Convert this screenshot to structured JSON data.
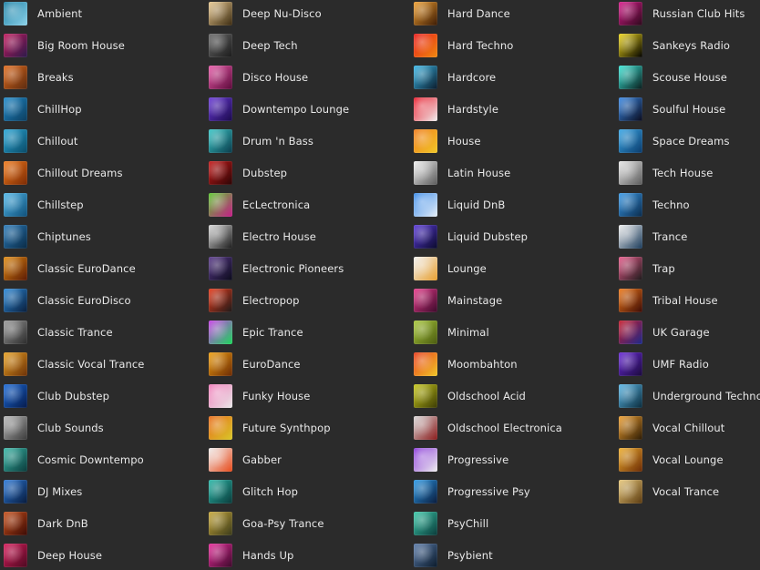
{
  "columns": [
    [
      {
        "label": "Ambient",
        "icon": "ambient-art-icon",
        "color1": "#1b7fa3",
        "color2": "#8fd3ea"
      },
      {
        "label": "Big Room House",
        "icon": "big-room-house-art-icon",
        "color1": "#c2185b",
        "color2": "#2a1a4a"
      },
      {
        "label": "Breaks",
        "icon": "breaks-art-icon",
        "color1": "#e06a1a",
        "color2": "#5a2a10"
      },
      {
        "label": "ChillHop",
        "icon": "chillhop-art-icon",
        "color1": "#1e88c8",
        "color2": "#0d3d5e"
      },
      {
        "label": "Chillout",
        "icon": "chillout-art-icon",
        "color1": "#29a6d6",
        "color2": "#0a4a66"
      },
      {
        "label": "Chillout Dreams",
        "icon": "chillout-dreams-art-icon",
        "color1": "#f07a1a",
        "color2": "#7a2a05"
      },
      {
        "label": "Chillstep",
        "icon": "chillstep-art-icon",
        "color1": "#4fb6e8",
        "color2": "#0f4f79"
      },
      {
        "label": "Chiptunes",
        "icon": "chiptunes-art-icon",
        "color1": "#2a7ab8",
        "color2": "#0a2a45"
      },
      {
        "label": "Classic EuroDance",
        "icon": "classic-eurodance-art-icon",
        "color1": "#e08a10",
        "color2": "#5a1a05"
      },
      {
        "label": "Classic EuroDisco",
        "icon": "classic-eurodisco-art-icon",
        "color1": "#2a88d8",
        "color2": "#0a1e3a"
      },
      {
        "label": "Classic Trance",
        "icon": "classic-trance-art-icon",
        "color1": "#9a9a9a",
        "color2": "#2a2a2a"
      },
      {
        "label": "Classic Vocal Trance",
        "icon": "classic-vocal-trance-art-icon",
        "color1": "#e8a020",
        "color2": "#6a3008"
      },
      {
        "label": "Club Dubstep",
        "icon": "club-dubstep-art-icon",
        "color1": "#1a6ad8",
        "color2": "#061a4a"
      },
      {
        "label": "Club Sounds",
        "icon": "club-sounds-art-icon",
        "color1": "#b8b8b8",
        "color2": "#3a3a3a"
      },
      {
        "label": "Cosmic Downtempo",
        "icon": "cosmic-downtempo-art-icon",
        "color1": "#3ab8a8",
        "color2": "#0a3a3a"
      },
      {
        "label": "DJ Mixes",
        "icon": "dj-mixes-art-icon",
        "color1": "#2a78d8",
        "color2": "#081a3a"
      },
      {
        "label": "Dark DnB",
        "icon": "dark-dnb-art-icon",
        "color1": "#c8501a",
        "color2": "#3a0a05"
      },
      {
        "label": "Deep House",
        "icon": "deep-house-art-icon",
        "color1": "#d81a5a",
        "color2": "#4a0a20"
      }
    ],
    [
      {
        "label": "Deep Nu-Disco",
        "icon": "deep-nu-disco-art-icon",
        "color1": "#e8c890",
        "color2": "#3a2a10"
      },
      {
        "label": "Deep Tech",
        "icon": "deep-tech-art-icon",
        "color1": "#6a6a6a",
        "color2": "#1a1a1a"
      },
      {
        "label": "Disco House",
        "icon": "disco-house-art-icon",
        "color1": "#e85aa8",
        "color2": "#5a0a3a"
      },
      {
        "label": "Downtempo Lounge",
        "icon": "downtempo-lounge-art-icon",
        "color1": "#6a3ad8",
        "color2": "#1a0a4a"
      },
      {
        "label": "Drum 'n Bass",
        "icon": "drum-n-bass-art-icon",
        "color1": "#3ac8c8",
        "color2": "#0a3a4a"
      },
      {
        "label": "Dubstep",
        "icon": "dubstep-art-icon",
        "color1": "#c81a1a",
        "color2": "#2a0505"
      },
      {
        "label": "EcLectronica",
        "icon": "eclectronica-art-icon",
        "color1": "#58c82a",
        "color2": "#c81a8a"
      },
      {
        "label": "Electro House",
        "icon": "electro-house-art-icon",
        "color1": "#d8d8d8",
        "color2": "#1a1a1a"
      },
      {
        "label": "Electronic Pioneers",
        "icon": "electronic-pioneers-art-icon",
        "color1": "#5a3a8a",
        "color2": "#0a0a1a"
      },
      {
        "label": "Electropop",
        "icon": "electropop-art-icon",
        "color1": "#e83a1a",
        "color2": "#1a1a1a"
      },
      {
        "label": "Epic Trance",
        "icon": "epic-trance-art-icon",
        "color1": "#c83ae8",
        "color2": "#1ad85a"
      },
      {
        "label": "EuroDance",
        "icon": "eurodance-art-icon",
        "color1": "#f0a010",
        "color2": "#6a2a05"
      },
      {
        "label": "Funky House",
        "icon": "funky-house-art-icon",
        "color1": "#f07ab8",
        "color2": "#e8e8e8"
      },
      {
        "label": "Future Synthpop",
        "icon": "future-synthpop-art-icon",
        "color1": "#e86a1a",
        "color2": "#d8c82a"
      },
      {
        "label": "Gabber",
        "icon": "gabber-art-icon",
        "color1": "#f0f0f0",
        "color2": "#e84a1a"
      },
      {
        "label": "Glitch Hop",
        "icon": "glitch-hop-art-icon",
        "color1": "#2ab8a8",
        "color2": "#0a3a3a"
      },
      {
        "label": "Goa-Psy Trance",
        "icon": "goa-psy-trance-art-icon",
        "color1": "#c8a83a",
        "color2": "#3a3a1a"
      },
      {
        "label": "Hands Up",
        "icon": "hands-up-art-icon",
        "color1": "#e82a9a",
        "color2": "#3a0a2a"
      }
    ],
    [
      {
        "label": "Hard Dance",
        "icon": "hard-dance-art-icon",
        "color1": "#f0a030",
        "color2": "#3a1a05"
      },
      {
        "label": "Hard Techno",
        "icon": "hard-techno-art-icon",
        "color1": "#e81a1a",
        "color2": "#f08a10"
      },
      {
        "label": "Hardcore",
        "icon": "hardcore-art-icon",
        "color1": "#3ab8e8",
        "color2": "#0a1a2a"
      },
      {
        "label": "Hardstyle",
        "icon": "hardstyle-art-icon",
        "color1": "#e81a2a",
        "color2": "#f0f0f0"
      },
      {
        "label": "House",
        "icon": "house-art-icon",
        "color1": "#f07a1a",
        "color2": "#f0c82a"
      },
      {
        "label": "Latin House",
        "icon": "latin-house-art-icon",
        "color1": "#f0f0f0",
        "color2": "#5a5a5a"
      },
      {
        "label": "Liquid DnB",
        "icon": "liquid-dnb-art-icon",
        "color1": "#3a8ae8",
        "color2": "#e8f0f8"
      },
      {
        "label": "Liquid Dubstep",
        "icon": "liquid-dubstep-art-icon",
        "color1": "#5a3ad8",
        "color2": "#0a0a2a"
      },
      {
        "label": "Lounge",
        "icon": "lounge-art-icon",
        "color1": "#f0f0f0",
        "color2": "#e8a030"
      },
      {
        "label": "Mainstage",
        "icon": "mainstage-art-icon",
        "color1": "#e83a8a",
        "color2": "#3a0a2a"
      },
      {
        "label": "Minimal",
        "icon": "minimal-art-icon",
        "color1": "#a8c83a",
        "color2": "#4a5a10"
      },
      {
        "label": "Moombahton",
        "icon": "moombahton-art-icon",
        "color1": "#e83a1a",
        "color2": "#f0c82a"
      },
      {
        "label": "Oldschool Acid",
        "icon": "oldschool-acid-art-icon",
        "color1": "#c8c81a",
        "color2": "#3a3a05"
      },
      {
        "label": "Oldschool Electronica",
        "icon": "oldschool-electronica-art-icon",
        "color1": "#d8d8d8",
        "color2": "#8a1a1a"
      },
      {
        "label": "Progressive",
        "icon": "progressive-art-icon",
        "color1": "#8a3ad8",
        "color2": "#f0f0f0"
      },
      {
        "label": "Progressive Psy",
        "icon": "progressive-psy-art-icon",
        "color1": "#2a9ae8",
        "color2": "#0a1a3a"
      },
      {
        "label": "PsyChill",
        "icon": "psychill-art-icon",
        "color1": "#3ac8a8",
        "color2": "#0a3a3a"
      },
      {
        "label": "Psybient",
        "icon": "psybient-art-icon",
        "color1": "#5a7aa8",
        "color2": "#0a1a2a"
      }
    ],
    [
      {
        "label": "Russian Club Hits",
        "icon": "russian-club-hits-art-icon",
        "color1": "#d81a8a",
        "color2": "#2a0a1a"
      },
      {
        "label": "Sankeys Radio",
        "icon": "sankeys-radio-art-icon",
        "color1": "#f0d81a",
        "color2": "#000000"
      },
      {
        "label": "Scouse House",
        "icon": "scouse-house-art-icon",
        "color1": "#3ae8d8",
        "color2": "#0a1a1a"
      },
      {
        "label": "Soulful House",
        "icon": "soulful-house-art-icon",
        "color1": "#3a8ae8",
        "color2": "#0a0a1a"
      },
      {
        "label": "Space Dreams",
        "icon": "space-dreams-art-icon",
        "color1": "#3aa8e8",
        "color2": "#0a3a6a"
      },
      {
        "label": "Tech House",
        "icon": "tech-house-art-icon",
        "color1": "#e8e8e8",
        "color2": "#5a5a5a"
      },
      {
        "label": "Techno",
        "icon": "techno-art-icon",
        "color1": "#3a9ae8",
        "color2": "#0a2a4a"
      },
      {
        "label": "Trance",
        "icon": "trance-art-icon",
        "color1": "#f0f0f0",
        "color2": "#1a3a5a"
      },
      {
        "label": "Trap",
        "icon": "trap-art-icon",
        "color1": "#e85a8a",
        "color2": "#1a1a1a"
      },
      {
        "label": "Tribal House",
        "icon": "tribal-house-art-icon",
        "color1": "#f07a1a",
        "color2": "#3a0a05"
      },
      {
        "label": "UK Garage",
        "icon": "uk-garage-art-icon",
        "color1": "#c81a2a",
        "color2": "#1a2a8a"
      },
      {
        "label": "UMF Radio",
        "icon": "umf-radio-art-icon",
        "color1": "#6a2ad8",
        "color2": "#1a0a3a"
      },
      {
        "label": "Underground Techno",
        "icon": "underground-techno-art-icon",
        "color1": "#5ab8e8",
        "color2": "#0a2a3a"
      },
      {
        "label": "Vocal Chillout",
        "icon": "vocal-chillout-art-icon",
        "color1": "#f0a030",
        "color2": "#2a1a05"
      },
      {
        "label": "Vocal Lounge",
        "icon": "vocal-lounge-art-icon",
        "color1": "#f0b030",
        "color2": "#6a2a05"
      },
      {
        "label": "Vocal Trance",
        "icon": "vocal-trance-art-icon",
        "color1": "#e8c87a",
        "color2": "#5a3a10"
      }
    ]
  ]
}
